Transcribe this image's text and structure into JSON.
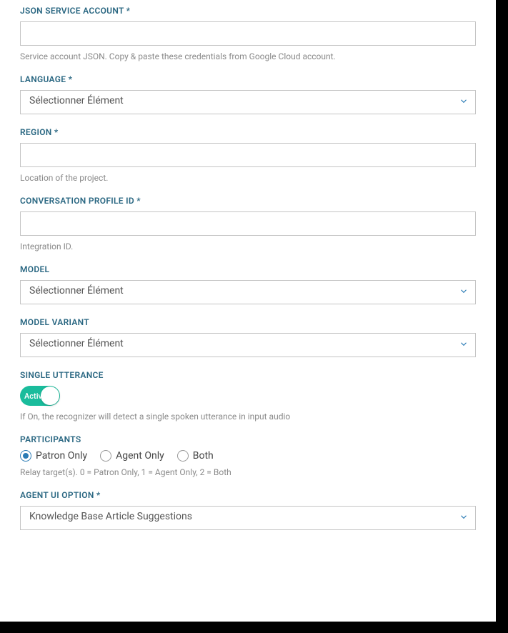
{
  "fields": {
    "json_service_account": {
      "label": "JSON SERVICE ACCOUNT *",
      "value": "",
      "help": "Service account JSON. Copy & paste these credentials from Google Cloud account."
    },
    "language": {
      "label": "LANGUAGE *",
      "selected": "Sélectionner Élément"
    },
    "region": {
      "label": "REGION *",
      "value": "",
      "help": "Location of the project."
    },
    "conversation_profile_id": {
      "label": "CONVERSATION PROFILE ID *",
      "value": "",
      "help": "Integration ID."
    },
    "model": {
      "label": "MODEL",
      "selected": "Sélectionner Élément"
    },
    "model_variant": {
      "label": "MODEL VARIANT",
      "selected": "Sélectionner Élément"
    },
    "single_utterance": {
      "label": "SINGLE UTTERANCE",
      "state": "Activé",
      "help": "If On, the recognizer will detect a single spoken utterance in input audio"
    },
    "participants": {
      "label": "PARTICIPANTS",
      "options": [
        "Patron Only",
        "Agent Only",
        "Both"
      ],
      "selected_index": 0,
      "help": "Relay target(s). 0 = Patron Only, 1 = Agent Only, 2 = Both"
    },
    "agent_ui_option": {
      "label": "AGENT UI OPTION *",
      "selected": "Knowledge Base Article Suggestions"
    }
  }
}
